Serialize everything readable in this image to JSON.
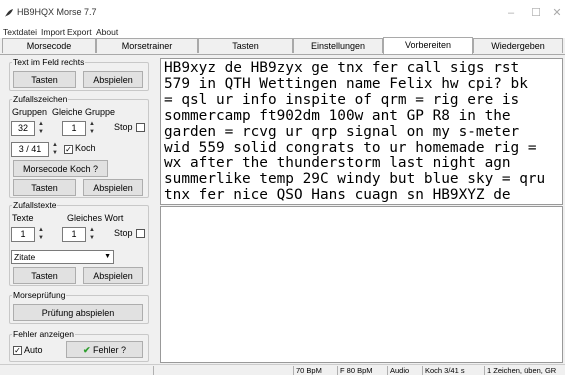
{
  "window": {
    "title": "HB9HQX Morse 7.7"
  },
  "menu": [
    "Textdatei",
    "Import",
    "Export",
    "About"
  ],
  "tabs": [
    {
      "label": "Morsecode"
    },
    {
      "label": "Morsetrainer"
    },
    {
      "label": "Tasten"
    },
    {
      "label": "Einstellungen"
    },
    {
      "label": "Vorbereiten",
      "active": true
    },
    {
      "label": "Wiedergeben"
    }
  ],
  "text_in_field": {
    "legend": "Text im Feld rechts",
    "key_button": "Tasten",
    "play_button": "Abspielen"
  },
  "random_chars": {
    "legend": "Zufallszeichen",
    "groups_label": "Gruppen",
    "same_group_label": "Gleiche Gruppe",
    "groups_value": "32",
    "same_group_value": "1",
    "stop_label": "Stop",
    "count_value": "3 / 41",
    "koch_label": "Koch",
    "koch_checked": true,
    "koch_button": "Morsecode Koch ?",
    "key_button": "Tasten",
    "play_button": "Abspielen"
  },
  "random_texts": {
    "legend": "Zufallstexte",
    "texts_label": "Texte",
    "same_word_label": "Gleiches Wort",
    "texts_value": "1",
    "same_word_value": "1",
    "stop_label": "Stop",
    "dropdown_value": "Zitate",
    "key_button": "Tasten",
    "play_button": "Abspielen"
  },
  "morse_test": {
    "legend": "Morseprüfung",
    "play_button": "Prüfung abspielen"
  },
  "errors": {
    "legend": "Fehler anzeigen",
    "auto_label": "Auto",
    "auto_checked": true,
    "errors_button": "Fehler ?",
    "check_color": "#2e9e2e"
  },
  "main_text": "HB9xyz de HB9zyx ge tnx fer call sigs rst\n579 in QTH Wettingen name Felix hw cpi? bk\n= qsl ur info inspite of qrm = rig ere is\nsommercamp ft902dm 100w ant GP R8 in the\ngarden = rcvg ur qrp signal on my s-meter\nwid 559 solid congrats to ur homemade rig =\nwx after the thunderstorm last night agn\nsummerlike temp 29C windy but blue sky = qru\ntnx fer nice QSO Hans cuagn sn HB9XYZ de",
  "status": [
    "70 BpM",
    "F 80 BpM",
    "Audio",
    "Koch 3/41 s",
    "1 Zeichen, üben, GR"
  ],
  "colors": {
    "accent": "#0a64c8"
  }
}
